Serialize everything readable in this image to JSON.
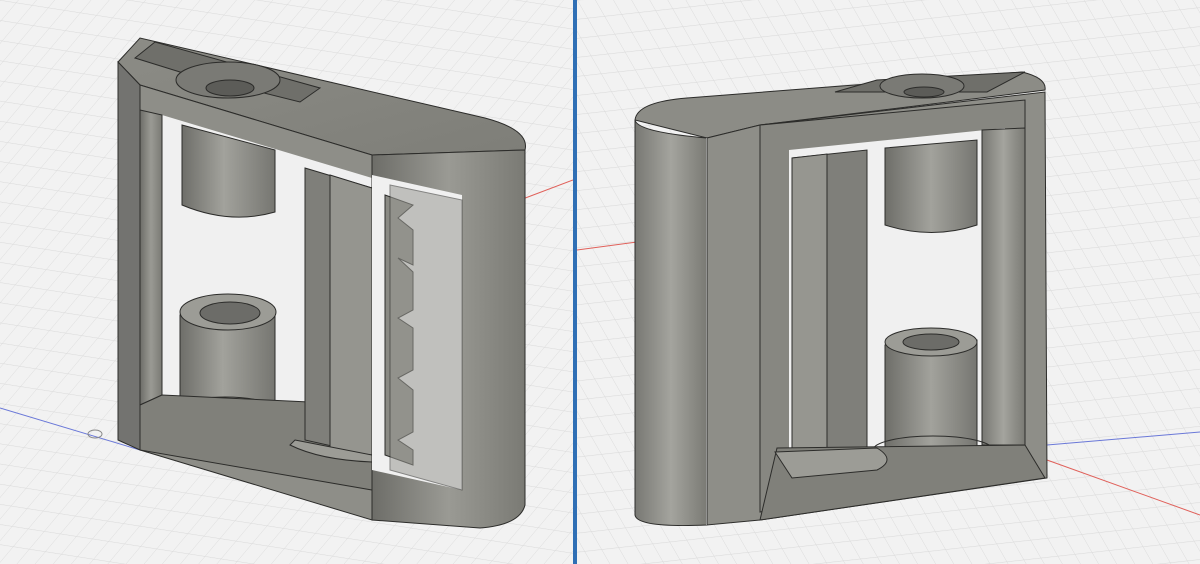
{
  "workspace": {
    "background": "#f2f2f2",
    "grid_minor": "#dadada",
    "grid_major": "#c4c4c4",
    "axis_x_color": "#e0605a",
    "axis_y_color": "#6a78d8",
    "splitter_color": "#2f6fb5"
  },
  "model": {
    "body_color": "#8a8a84",
    "body_light": "#a8a8a2",
    "body_dark": "#6a6a65",
    "edge_color": "#2c2c2a"
  },
  "viewports": [
    {
      "view": "left-perspective"
    },
    {
      "view": "right-perspective"
    }
  ]
}
